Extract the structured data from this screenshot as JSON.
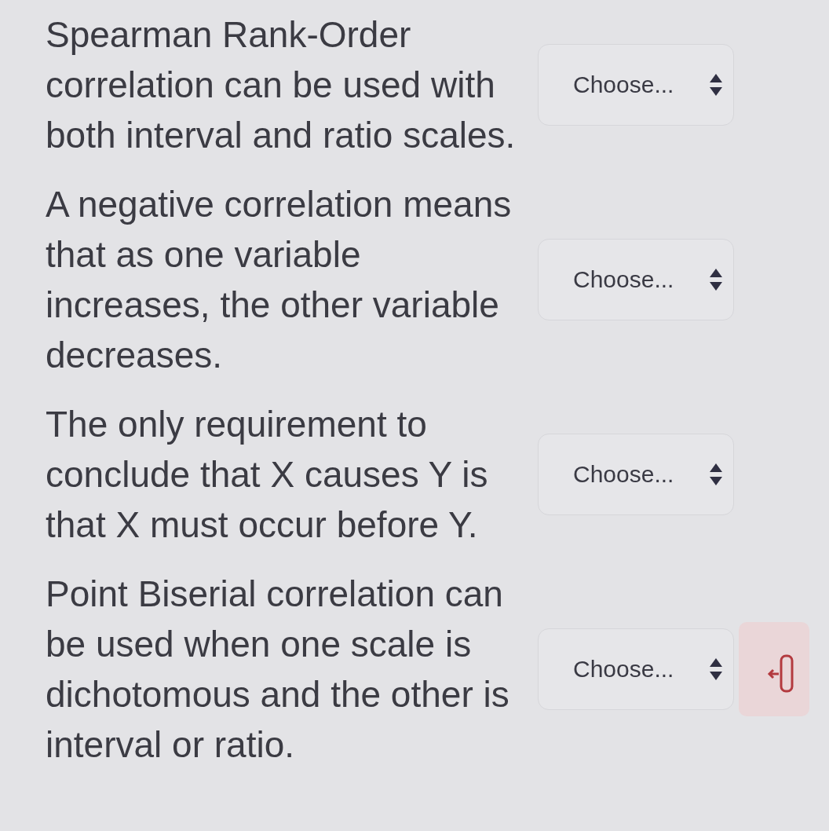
{
  "questions": [
    {
      "statement": "Spearman Rank-Order correlation can be used with both interval and ratio scales.",
      "dropdown_text": "Choose...",
      "marked": false
    },
    {
      "statement": "A negative correlation means that as one variable increases, the other variable decreases.",
      "dropdown_text": "Choose...",
      "marked": false
    },
    {
      "statement": "The only requirement to conclude that X causes Y is that X must occur before Y.",
      "dropdown_text": "Choose...",
      "marked": false
    },
    {
      "statement": "Point Biserial correlation can be used when one scale is dichotomous and the other is interval or ratio.",
      "dropdown_text": "Choose...",
      "marked": true
    }
  ]
}
